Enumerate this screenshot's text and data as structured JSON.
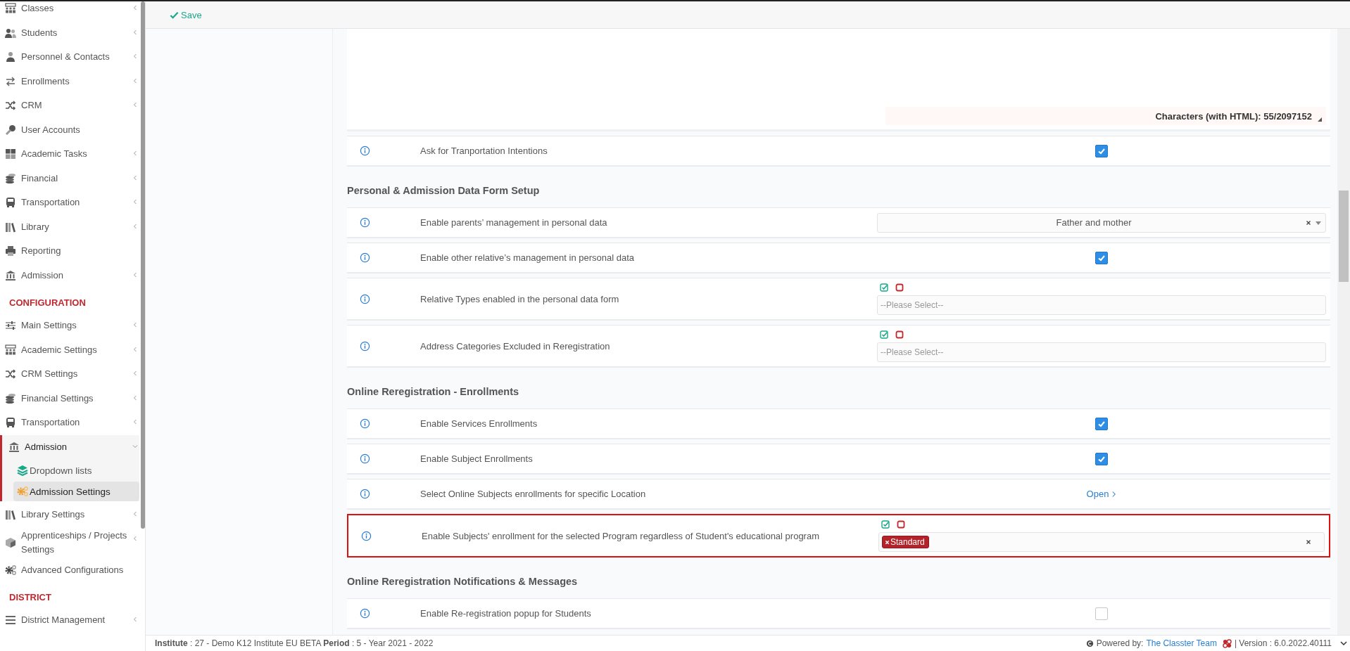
{
  "toolbar": {
    "save": "Save"
  },
  "sidebar": {
    "groups": [
      {
        "items": [
          {
            "label": "Classes",
            "expanded": false
          },
          {
            "label": "Students",
            "expanded": false
          },
          {
            "label": "Personnel & Contacts",
            "expanded": false
          },
          {
            "label": "Enrollments",
            "expanded": false
          },
          {
            "label": "CRM",
            "expanded": false
          },
          {
            "label": "User Accounts"
          },
          {
            "label": "Academic Tasks",
            "expanded": false
          },
          {
            "label": "Financial",
            "expanded": false
          },
          {
            "label": "Transportation",
            "expanded": false
          },
          {
            "label": "Library",
            "expanded": false
          },
          {
            "label": "Reporting"
          },
          {
            "label": "Admission",
            "expanded": false
          }
        ]
      },
      {
        "title": "CONFIGURATION",
        "items": [
          {
            "label": "Main Settings",
            "expanded": false
          },
          {
            "label": "Academic Settings",
            "expanded": false
          },
          {
            "label": "CRM Settings",
            "expanded": false
          },
          {
            "label": "Financial Settings",
            "expanded": false
          },
          {
            "label": "Transportation",
            "expanded": false
          },
          {
            "label": "Admission",
            "expanded": true,
            "children": [
              {
                "label": "Dropdown lists",
                "selected": false
              },
              {
                "label": "Admission Settings",
                "selected": true
              }
            ]
          },
          {
            "label": "Library Settings",
            "expanded": false
          },
          {
            "label": "Apprenticeships / Projects Settings",
            "expanded": false
          },
          {
            "label": "Advanced Configurations"
          }
        ]
      },
      {
        "title": "DISTRICT",
        "items": [
          {
            "label": "District Management",
            "expanded": false
          }
        ]
      }
    ]
  },
  "editor": {
    "char_count": "Characters (with HTML): 55/2097152"
  },
  "sections": [
    {
      "rows": [
        {
          "kind": "checkbox",
          "label": "Ask for Tranportation Intentions",
          "checked": true,
          "highlighted": false
        }
      ]
    },
    {
      "title": "Personal & Admission Data Form Setup",
      "rows": [
        {
          "kind": "select",
          "label": "Enable parents’ management in personal data",
          "value": "Father and mother",
          "highlighted": false
        },
        {
          "kind": "checkbox",
          "label": "Enable other relative’s management in personal data",
          "checked": true,
          "highlighted": false
        },
        {
          "kind": "multiselect",
          "label": "Relative Types enabled in the personal data form",
          "placeholder": "--Please Select--",
          "highlighted": false
        },
        {
          "kind": "multiselect",
          "label": "Address Categories Excluded in Reregistration",
          "placeholder": "--Please Select--",
          "highlighted": false
        }
      ]
    },
    {
      "title": "Online Reregistration - Enrollments",
      "rows": [
        {
          "kind": "checkbox",
          "label": "Enable Services Enrollments",
          "checked": true,
          "highlighted": false
        },
        {
          "kind": "checkbox",
          "label": "Enable Subject Enrollments",
          "checked": true,
          "highlighted": false
        },
        {
          "kind": "link",
          "label": "Select Online Subjects enrollments for specific Location",
          "link": "Open",
          "highlighted": false
        },
        {
          "kind": "multiselect",
          "label": "Enable Subjects' enrollment for the selected Program regardless of Student's educational program",
          "tags": [
            "Standard"
          ],
          "highlighted": true
        }
      ]
    },
    {
      "title": "Online Reregistration Notifications & Messages",
      "rows": [
        {
          "kind": "checkbox",
          "label": "Enable Re-registration popup for Students",
          "checked": false,
          "highlighted": false
        }
      ]
    }
  ],
  "footer": {
    "info": "**Institute** : 27 - Demo K12 Institute EU BETA **Period** : 5 - Year 2021 - 2022",
    "powered_by": "Powered by:",
    "team_link": "The Classter Team",
    "version": "| Version : 6.0.2022.40111"
  }
}
